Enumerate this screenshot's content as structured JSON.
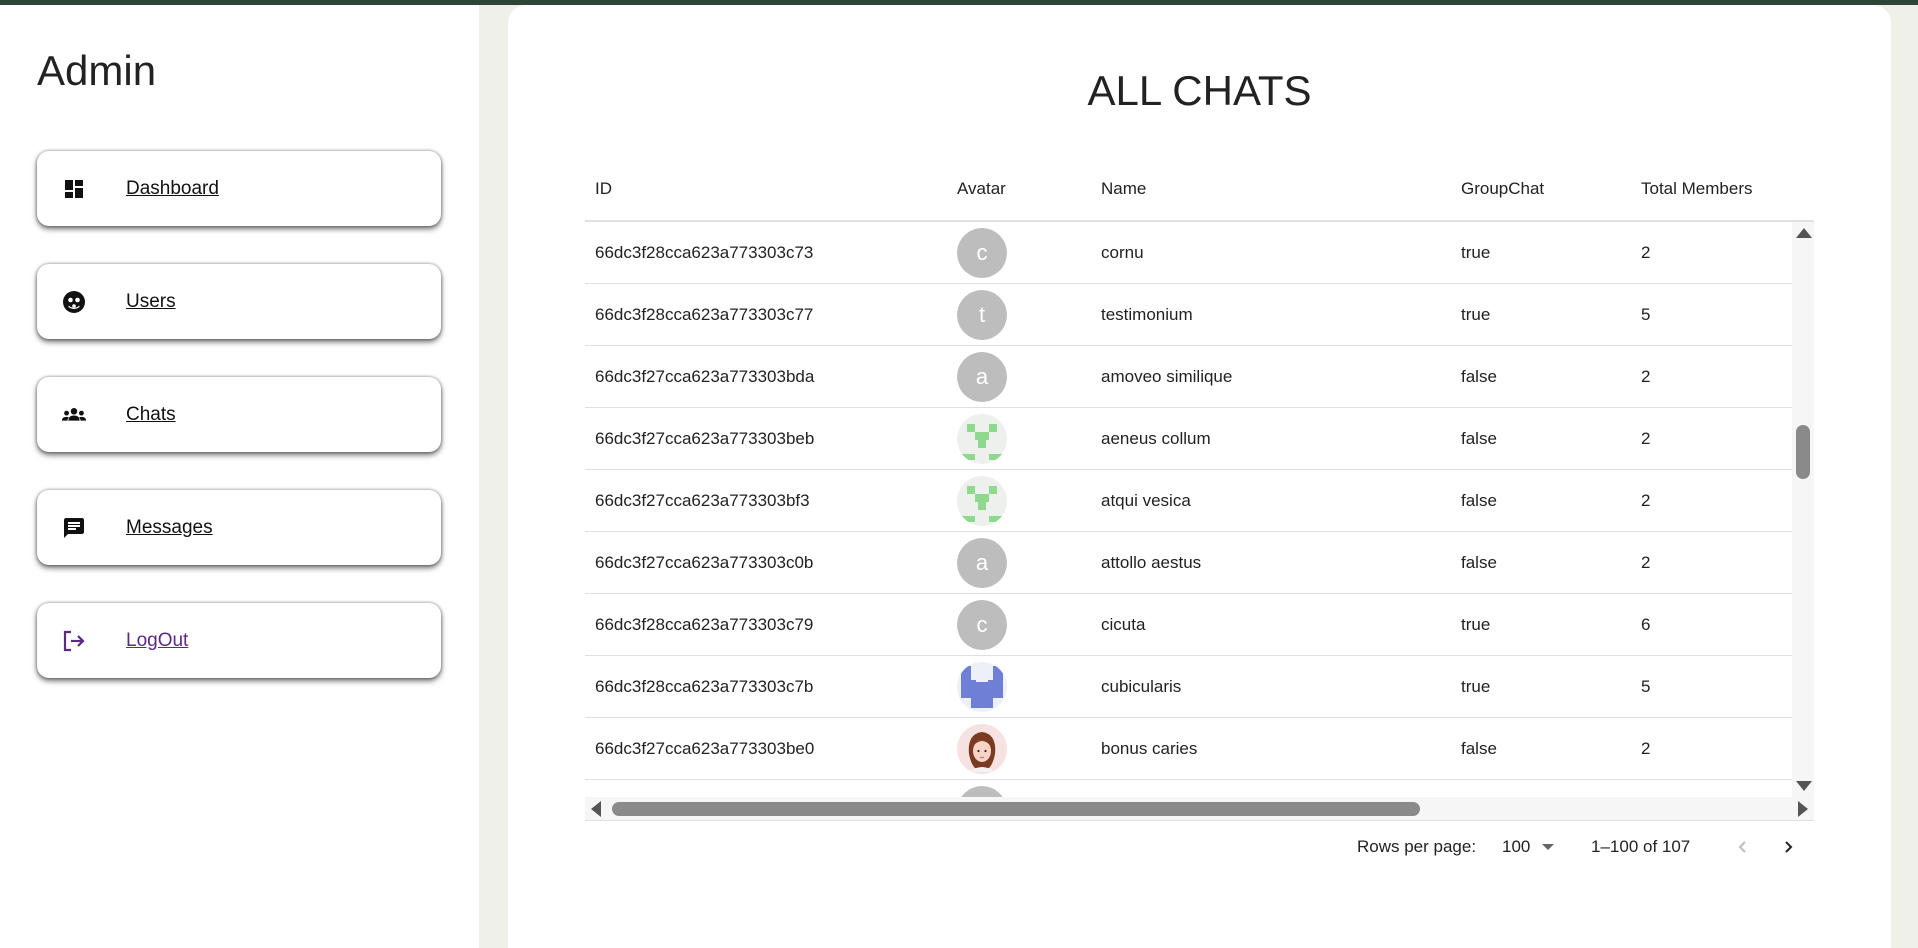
{
  "sidebar": {
    "title": "Admin",
    "items": [
      {
        "label": "Dashboard",
        "icon": "dashboard-icon"
      },
      {
        "label": "Users",
        "icon": "users-face-icon"
      },
      {
        "label": "Chats",
        "icon": "groups-icon"
      },
      {
        "label": "Messages",
        "icon": "message-icon"
      },
      {
        "label": "LogOut",
        "icon": "logout-icon"
      }
    ]
  },
  "main": {
    "title": "ALL CHATS",
    "columns": [
      "ID",
      "Avatar",
      "Name",
      "GroupChat",
      "Total Members"
    ],
    "rows": [
      {
        "id": "66dc3f28cca623a773303c73",
        "avatar": "c",
        "name": "cornu",
        "group": "true",
        "members": "2"
      },
      {
        "id": "66dc3f28cca623a773303c77",
        "avatar": "t",
        "name": "testimonium",
        "group": "true",
        "members": "5"
      },
      {
        "id": "66dc3f27cca623a773303bda",
        "avatar": "a",
        "name": "amoveo similique",
        "group": "false",
        "members": "2"
      },
      {
        "id": "66dc3f27cca623a773303beb",
        "avatar": "identicon-green",
        "name": "aeneus collum",
        "group": "false",
        "members": "2"
      },
      {
        "id": "66dc3f27cca623a773303bf3",
        "avatar": "identicon-green",
        "name": "atqui vesica",
        "group": "false",
        "members": "2"
      },
      {
        "id": "66dc3f27cca623a773303c0b",
        "avatar": "a",
        "name": "attollo aestus",
        "group": "false",
        "members": "2"
      },
      {
        "id": "66dc3f28cca623a773303c79",
        "avatar": "c",
        "name": "cicuta",
        "group": "true",
        "members": "6"
      },
      {
        "id": "66dc3f28cca623a773303c7b",
        "avatar": "identicon-blue",
        "name": "cubicularis",
        "group": "true",
        "members": "5"
      },
      {
        "id": "66dc3f27cca623a773303be0",
        "avatar": "photo-girl",
        "name": "bonus caries",
        "group": "false",
        "members": "2"
      }
    ]
  },
  "pagination": {
    "rows_per_page_label": "Rows per page:",
    "rows_per_page_value": "100",
    "range": "1–100 of 107"
  },
  "colors": {
    "topbar": "#2c4537",
    "avatar_gray": "#bdbdbd",
    "identicon_green": "#8fd98f",
    "identicon_blue": "#6f7fd6",
    "logout_accent": "#5b2a86"
  }
}
